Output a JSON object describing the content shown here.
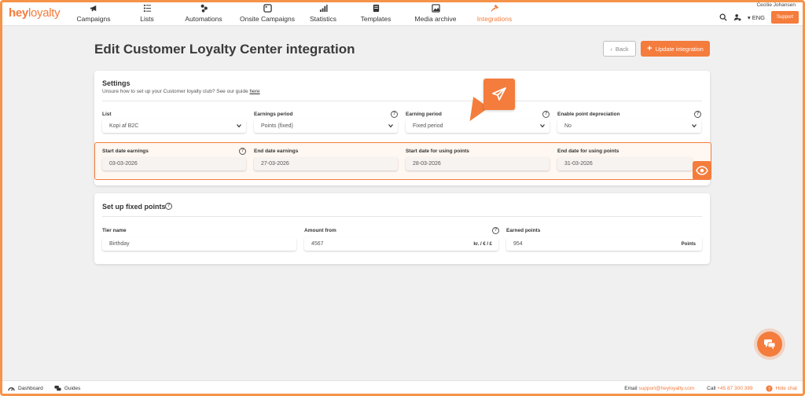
{
  "app": {
    "logo_part1": "hey",
    "logo_part2": "loyalty"
  },
  "nav": {
    "items": [
      {
        "label": "Campaigns",
        "icon": "megaphone-icon"
      },
      {
        "label": "Lists",
        "icon": "list-icon"
      },
      {
        "label": "Automations",
        "icon": "automation-icon"
      },
      {
        "label": "Onsite Campaigns",
        "icon": "window-icon"
      },
      {
        "label": "Statistics",
        "icon": "bar-chart-icon"
      },
      {
        "label": "Templates",
        "icon": "template-icon"
      },
      {
        "label": "Media archive",
        "icon": "image-icon"
      },
      {
        "label": "Integrations",
        "icon": "plug-icon",
        "active": true
      }
    ]
  },
  "topright": {
    "username": "Cecilie Johansen",
    "language": "ENG",
    "support": "Support"
  },
  "page": {
    "title": "Edit Customer Loyalty Center integration",
    "back": "Back",
    "update": "Update integration"
  },
  "settings": {
    "title": "Settings",
    "subtitle": "Unsure how to set up your Customer loyalty club? See our guide ",
    "guide_link": "here",
    "row1": [
      {
        "label": "List",
        "value": "Kopi af B2C"
      },
      {
        "label": "Earnings period",
        "value": "Points (fixed)"
      },
      {
        "label": "Earning period",
        "value": "Fixed period"
      },
      {
        "label": "Enable point depreciation",
        "value": "No"
      }
    ],
    "row2": [
      {
        "label": "Start date earnings",
        "value": "03-03-2026"
      },
      {
        "label": "End date earnings",
        "value": "27-03-2026"
      },
      {
        "label": "Start date for using points",
        "value": "28-03-2026"
      },
      {
        "label": "End date for using points",
        "value": "31-03-2026"
      }
    ]
  },
  "fixed": {
    "title": "Set up fixed points",
    "tier_label": "Tier name",
    "tier_value": "Birthday",
    "amount_label": "Amount from",
    "amount_value": "4567",
    "amount_suffix": "kr. / € / £",
    "points_label": "Earned points",
    "points_value": "954",
    "points_suffix": "Points"
  },
  "bottom": {
    "dashboard": "Dashboard",
    "guides": "Guides",
    "email_label": "Email",
    "email": "support@heyloyalty.com",
    "call_label": "Call",
    "phone": "+45 87 300 399",
    "hide_chat": "Hide chat"
  },
  "colors": {
    "accent": "#f47c3c"
  }
}
